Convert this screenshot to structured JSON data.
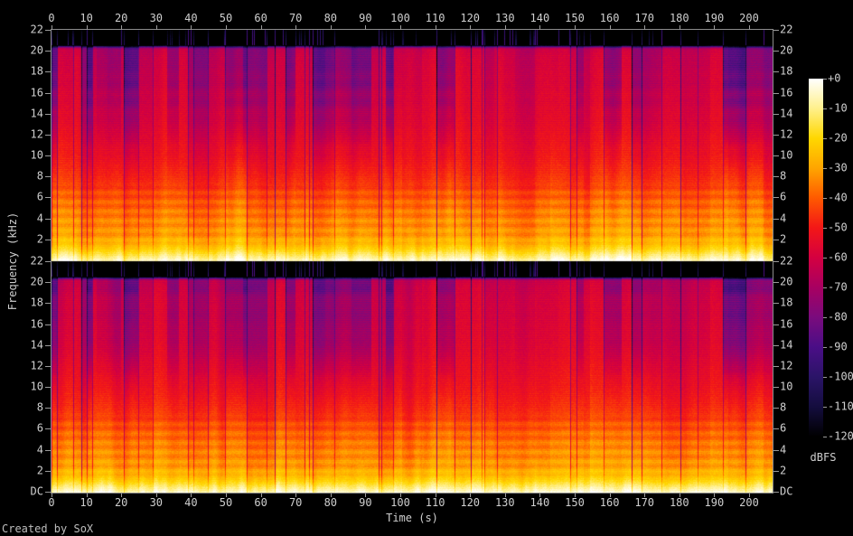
{
  "window": {
    "footer": "Created by SoX"
  },
  "chart_data": {
    "type": "heatmap",
    "subtype": "stereo-audio-spectrogram",
    "title": "",
    "xlabel": "Time (s)",
    "ylabel": "Frequency (kHz)",
    "channel_count": 2,
    "x_axis": {
      "min_s": 0,
      "max_s": 206.7,
      "tick_step_s": 10,
      "tick_labels": [
        "0",
        "10",
        "20",
        "30",
        "40",
        "50",
        "60",
        "70",
        "80",
        "90",
        "100",
        "110",
        "120",
        "130",
        "140",
        "150",
        "160",
        "170",
        "180",
        "190",
        "200"
      ]
    },
    "y_axis": {
      "min_khz": 0,
      "max_khz": 22,
      "tick_step_khz": 2,
      "tick_labels_channel_top": [
        "22",
        "20",
        "18",
        "16",
        "14",
        "12",
        "10",
        "8",
        "6",
        "4",
        "2"
      ],
      "tick_labels_channel_bottom": [
        "22",
        "20",
        "18",
        "16",
        "14",
        "12",
        "10",
        "8",
        "6",
        "4",
        "2",
        "DC"
      ]
    },
    "colorbar": {
      "label": "dBFS",
      "max_db": 0,
      "min_db": -120,
      "tick_step_db": 10,
      "tick_labels": [
        "+0",
        "-10",
        "-20",
        "-30",
        "-40",
        "-50",
        "-60",
        "-70",
        "-80",
        "-90",
        "-100",
        "-110",
        "-120"
      ],
      "palette": [
        {
          "db": -120,
          "color": "#000000"
        },
        {
          "db": -110,
          "color": "#140d3e"
        },
        {
          "db": -100,
          "color": "#2b1468"
        },
        {
          "db": -90,
          "color": "#4a0e86"
        },
        {
          "db": -80,
          "color": "#7a0b7d"
        },
        {
          "db": -70,
          "color": "#a80061"
        },
        {
          "db": -60,
          "color": "#d40040"
        },
        {
          "db": -50,
          "color": "#f31717"
        },
        {
          "db": -40,
          "color": "#ff5a00"
        },
        {
          "db": -30,
          "color": "#ffa500"
        },
        {
          "db": -20,
          "color": "#ffd700"
        },
        {
          "db": -10,
          "color": "#fff08c"
        },
        {
          "db": 0,
          "color": "#ffffff"
        }
      ]
    },
    "signal_model": {
      "lowpass_cutoff_khz": 20.45,
      "avg_spectrum_dbfs_by_khz": [
        [
          0,
          -3
        ],
        [
          0.3,
          -8
        ],
        [
          0.7,
          -14
        ],
        [
          1.1,
          -20
        ],
        [
          1.6,
          -25
        ],
        [
          2.2,
          -29
        ],
        [
          3,
          -32
        ],
        [
          4,
          -34
        ],
        [
          5,
          -37
        ],
        [
          6,
          -40
        ],
        [
          7,
          -44
        ],
        [
          8,
          -47
        ],
        [
          9,
          -49
        ],
        [
          10,
          -51
        ],
        [
          12,
          -53
        ],
        [
          14,
          -55
        ],
        [
          16,
          -56
        ],
        [
          18,
          -57
        ],
        [
          19.5,
          -58
        ],
        [
          20.2,
          -60
        ],
        [
          20.38,
          -75
        ],
        [
          20.55,
          -118
        ],
        [
          22,
          -120
        ]
      ],
      "harmonic_band_ripple": {
        "region_khz": [
          1.5,
          7.5
        ],
        "period_khz": 0.9,
        "amplitude_db": 2.5
      },
      "hf_quiet_stripe_depth_db": [
        9,
        29
      ],
      "hf_quiet_stripe_region_khz": [
        7,
        20.4
      ],
      "gap_line_attenuation_db": [
        22,
        42
      ],
      "transient_lines_peak_db": -92
    }
  },
  "text_color": "#cfcfcf",
  "axis_color": "#8c8c8c"
}
